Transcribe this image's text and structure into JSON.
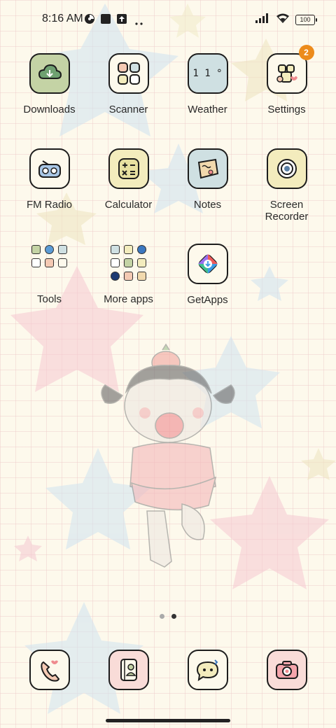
{
  "status_bar": {
    "time": "8:16 AM",
    "battery": "100",
    "icons": [
      "pinwheel-icon",
      "notification-square-icon",
      "upload-icon",
      "more-dots-icon",
      "signal-icon",
      "wifi-icon",
      "battery-icon"
    ]
  },
  "colors": {
    "background": "#fdf9ec",
    "grid_line": "#ecc8c8",
    "badge": "#ec8b1b",
    "icon_border": "#1d1d1d"
  },
  "apps": [
    {
      "label": "Downloads",
      "icon": "download-cloud-icon",
      "bg": "#c4d3a5"
    },
    {
      "label": "Scanner",
      "icon": "scanner-icon",
      "bg": "#fdf9ec"
    },
    {
      "label": "Weather",
      "icon": "weather-icon",
      "bg": "#cfe0e2",
      "icon_text": "1 1 °"
    },
    {
      "label": "Settings",
      "icon": "gear-icon",
      "bg": "#fdf9ec",
      "badge": "2"
    },
    {
      "label": "FM Radio",
      "icon": "radio-icon",
      "bg": "#fdf9ec"
    },
    {
      "label": "Calculator",
      "icon": "calculator-icon",
      "bg": "#f3ecbd"
    },
    {
      "label": "Notes",
      "icon": "notes-icon",
      "bg": "#cfe0e2"
    },
    {
      "label": "Screen Recorder",
      "label_line1": "Screen",
      "label_line2": "Recorder",
      "icon": "screen-recorder-icon",
      "bg": "#f3ecbd"
    },
    {
      "label": "GetApps",
      "icon": "getapps-icon",
      "bg": "#fdf9ec"
    }
  ],
  "folders": [
    {
      "label": "Tools",
      "icon": "tools-folder-icon"
    },
    {
      "label": "More apps",
      "icon": "more-apps-folder-icon"
    }
  ],
  "dock": [
    {
      "icon": "phone-icon",
      "bg": "#fdf9ec"
    },
    {
      "icon": "contacts-icon",
      "bg": "#f9dcd8"
    },
    {
      "icon": "messages-icon",
      "bg": "#fdf9ec"
    },
    {
      "icon": "camera-icon",
      "bg": "#f9dcd8"
    }
  ],
  "page_indicator": {
    "total": 2,
    "current": 2
  }
}
